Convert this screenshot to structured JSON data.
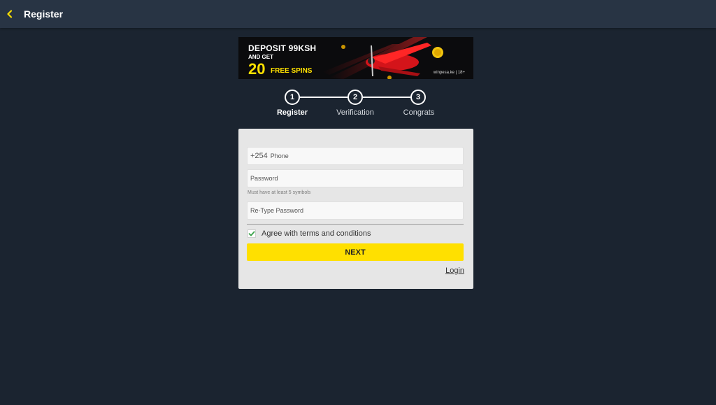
{
  "header": {
    "title": "Register",
    "back_icon": "chevron-left-icon",
    "accent": "#ffe000"
  },
  "banner": {
    "line1": "DEPOSIT 99KSH",
    "line2": "AND GET",
    "big_number": "20",
    "spins": "FREE SPINS",
    "legal": "winpesa.ke | 18+"
  },
  "stepper": {
    "steps": [
      {
        "number": "1",
        "label": "Register",
        "active": true
      },
      {
        "number": "2",
        "label": "Verification",
        "active": false
      },
      {
        "number": "3",
        "label": "Congrats",
        "active": false
      }
    ]
  },
  "form": {
    "phone_prefix": "+254",
    "phone_placeholder": "Phone",
    "password_placeholder": "Password",
    "password_hint": "Must have at least 5 symbols",
    "retype_placeholder": "Re-Type Password",
    "agree_label": "Agree with terms and conditions",
    "agree_checked": true,
    "next_label": "NEXT",
    "login_label": "Login"
  },
  "colors": {
    "background": "#1b2430",
    "topbar": "#283444",
    "card": "#e6e6e6",
    "button": "#ffe000",
    "check": "#3aa34a"
  }
}
